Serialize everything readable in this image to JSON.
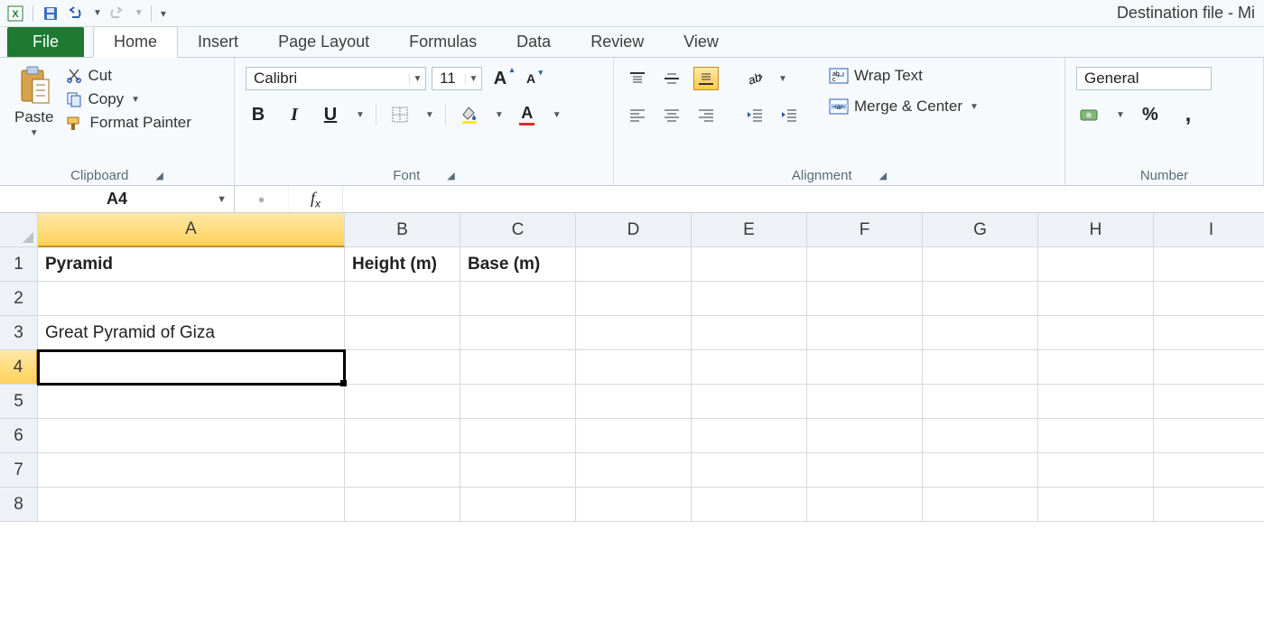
{
  "app_title": "Destination file  -  Mi",
  "qat": {
    "save": "Save",
    "undo": "Undo",
    "redo": "Redo"
  },
  "tabs": {
    "file": "File",
    "home": "Home",
    "insert": "Insert",
    "page_layout": "Page Layout",
    "formulas": "Formulas",
    "data": "Data",
    "review": "Review",
    "view": "View"
  },
  "clipboard": {
    "paste": "Paste",
    "cut": "Cut",
    "copy": "Copy",
    "format_painter": "Format Painter",
    "group": "Clipboard"
  },
  "font": {
    "name": "Calibri",
    "size": "11",
    "bold": "B",
    "italic": "I",
    "underline": "U",
    "group": "Font"
  },
  "alignment": {
    "wrap": "Wrap Text",
    "merge": "Merge & Center",
    "group": "Alignment"
  },
  "number": {
    "format": "General",
    "percent": "%",
    "comma": ",",
    "group": "Number"
  },
  "name_box": "A4",
  "formula_value": "",
  "columns": [
    "A",
    "B",
    "C",
    "D",
    "E",
    "F",
    "G",
    "H",
    "I"
  ],
  "rows": [
    "1",
    "2",
    "3",
    "4",
    "5",
    "6",
    "7",
    "8"
  ],
  "selected": {
    "col": 0,
    "row": 3
  },
  "cells": {
    "r1": {
      "A": "Pyramid",
      "B": "Height (m)",
      "C": "Base (m)"
    },
    "r3": {
      "A": "Great Pyramid of Giza"
    }
  }
}
